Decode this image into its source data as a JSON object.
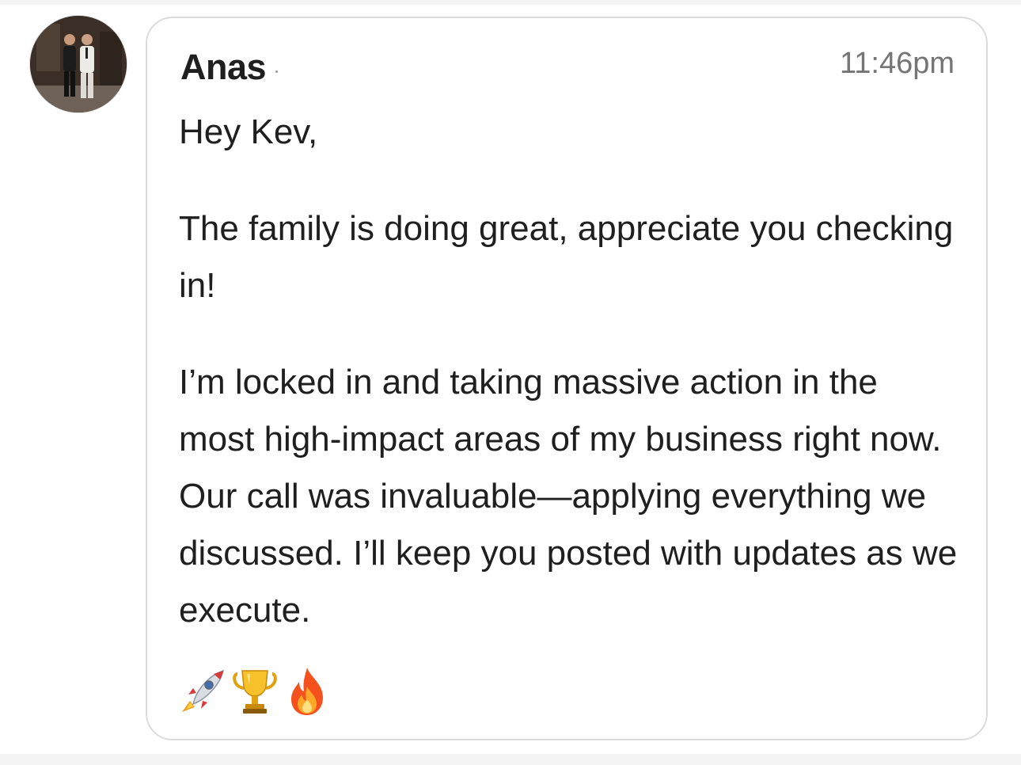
{
  "message": {
    "sender": "Anas",
    "time": "11:46pm",
    "paragraphs": [
      "Hey Kev,",
      "The family is doing great, appreciate you checking in!",
      "I’m locked in and taking massive action in the most high-impact areas of my business right now. Our call was invaluable—applying everything we discussed. I’ll keep you posted with updates as we execute."
    ],
    "reactions": [
      "rocket-icon",
      "trophy-icon",
      "fire-icon"
    ]
  },
  "colors": {
    "bubble_border": "#dcdcdc",
    "text": "#1f1f1f",
    "time": "#757575",
    "background": "#ffffff"
  }
}
